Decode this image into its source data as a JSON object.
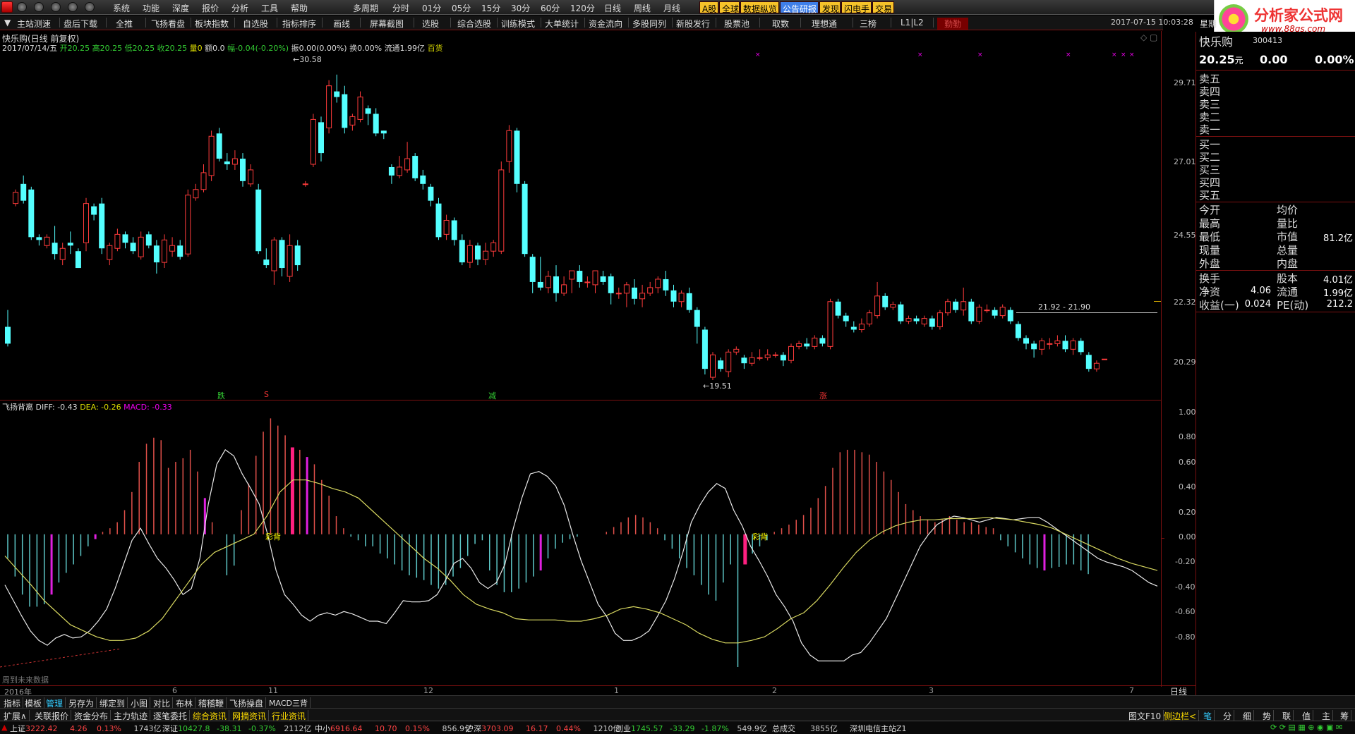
{
  "menu": [
    "系统",
    "功能",
    "深度",
    "报价",
    "分析",
    "工具",
    "帮助"
  ],
  "menu2": [
    "多周期",
    "分时",
    "01分",
    "05分",
    "15分",
    "30分",
    "60分",
    "120分",
    "日线",
    "周线",
    "月线"
  ],
  "highlight_tabs": [
    {
      "label": "A股",
      "bg": "#f6c32a"
    },
    {
      "label": "全球",
      "bg": "#f6c32a"
    },
    {
      "label": "数据纵览",
      "bg": "#f6c32a"
    },
    {
      "label": "公告研报",
      "bg": "#3f7fe8"
    },
    {
      "label": "发现",
      "bg": "#f6c32a"
    },
    {
      "label": "闪电手",
      "bg": "#f6c32a"
    },
    {
      "label": "交易",
      "bg": "#f6c32a"
    }
  ],
  "toolbar": [
    "主站测速",
    "盘后下载",
    "全推",
    "飞扬看盘",
    "板块指数",
    "自选股",
    "指标排序",
    "画线",
    "屏幕截图",
    "选股",
    "综合选股",
    "训练模式",
    "大单统计",
    "资金流向",
    "多股同列",
    "新股发行",
    "股票池",
    "取数",
    "理想通",
    "三榜",
    "L1|L2",
    "勤勤"
  ],
  "datetime": "2017-07-15  10:03:28",
  "weekday": "星期",
  "brand": {
    "title": "分析家公式网",
    "url": "www.88gs.com"
  },
  "stock": {
    "name": "快乐购",
    "code": "300413",
    "price": "20.25",
    "unit": "元",
    "change": "0.00",
    "pct": "0.00%"
  },
  "chart_title": "快乐购(日线 前复权)",
  "ohlc_line": {
    "date": "2017/07/14/五",
    "open": "开20.25",
    "high": "高20.25",
    "low": "低20.25",
    "close": "收20.25",
    "vol": "量0",
    "amt": "额0.0",
    "amp": "幅-0.04(-0.20%)",
    "zhen": "振0.00(0.00%)",
    "huan": "换0.00%",
    "liutong": "流通1.99亿",
    "sector": "百货"
  },
  "annotations": {
    "high": "30.58",
    "low": "19.51",
    "range": "21.92 - 21.90",
    "m_die": "跌",
    "m_s": "S",
    "m_jian": "减",
    "m_zhang": "涨"
  },
  "price_axis": [
    "29.71",
    "27.01",
    "24.55",
    "22.32",
    "20.29"
  ],
  "indicator": {
    "name": "飞扬背离",
    "diff": "DIFF: -0.43",
    "dea": "DEA: -0.26",
    "macd": "MACD: -0.33",
    "tag": "彩背",
    "future": "周到未来数据"
  },
  "macd_axis": [
    "1.00",
    "0.80",
    "0.60",
    "0.40",
    "0.20",
    "0.00",
    "-0.20",
    "-0.40",
    "-0.60",
    "-0.80"
  ],
  "time_axis": {
    "year": "2016年",
    "labels": [
      "6",
      "11",
      "12",
      "1",
      "2",
      "3",
      "7"
    ],
    "period": "日线"
  },
  "quote": {
    "sells": [
      "卖五",
      "卖四",
      "卖三",
      "卖二",
      "卖一"
    ],
    "buys": [
      "买一",
      "买二",
      "买三",
      "买四",
      "买五"
    ],
    "rows": [
      {
        "l1": "今开",
        "v1": "",
        "l2": "均价",
        "v2": ""
      },
      {
        "l1": "最高",
        "v1": "",
        "l2": "量比",
        "v2": ""
      },
      {
        "l1": "最低",
        "v1": "",
        "l2": "市值",
        "v2": "81.2亿"
      },
      {
        "l1": "现量",
        "v1": "",
        "l2": "总量",
        "v2": ""
      },
      {
        "l1": "外盘",
        "v1": "",
        "l2": "内盘",
        "v2": ""
      }
    ],
    "rows2": [
      {
        "l1": "换手",
        "v1": "",
        "l2": "股本",
        "v2": "4.01亿"
      },
      {
        "l1": "净资",
        "v1": "4.06",
        "l2": "流通",
        "v2": "1.99亿"
      },
      {
        "l1": "收益(一)",
        "v1": "0.024",
        "l2": "PE(动)",
        "v2": "212.2"
      }
    ]
  },
  "bottom_tabs1": [
    "指标",
    "模板",
    "管理",
    "另存为",
    "绑定到",
    "小图",
    "对比",
    "布林",
    "稽稽鞭",
    "飞扬操盘",
    "MACD三背"
  ],
  "bottom_tabs2": [
    "扩展∧",
    "关联报价",
    "资金分布",
    "主力轨迹",
    "逐笔委托",
    "综合资讯",
    "网摘资讯",
    "行业资讯"
  ],
  "right_bottom": {
    "tuwen": "图文F10",
    "cebian": "侧边栏<",
    "icons": [
      "笔",
      "分",
      "细",
      "势",
      "联",
      "值",
      "主",
      "筹"
    ]
  },
  "status": [
    {
      "name": "上证",
      "val": "3222.42",
      "chg": "4.26",
      "pct": "0.13%",
      "amt": "1743亿"
    },
    {
      "name": "深证",
      "val": "10427.8",
      "chg": "-38.31",
      "pct": "-0.37%",
      "amt": "2112亿"
    },
    {
      "name": "中小",
      "val": "6916.64",
      "chg": "10.70",
      "pct": "0.15%",
      "amt": "856.9亿"
    },
    {
      "name": "沪深",
      "val": "3703.09",
      "chg": "16.17",
      "pct": "0.44%",
      "amt": "1210亿"
    },
    {
      "name": "创业",
      "val": "1745.57",
      "chg": "-33.29",
      "pct": "-1.87%",
      "amt": "549.9亿"
    }
  ],
  "status_tail": {
    "label": "总成交",
    "amt": "3855亿",
    "server": "深圳电信主站Z1"
  },
  "chart_data": {
    "type": "candlestick",
    "y_range": [
      19.3,
      31.2
    ],
    "candles": [
      [
        21.4,
        20.8,
        22.0,
        20.7
      ],
      [
        25.8,
        26.2,
        26.3,
        25.7
      ],
      [
        26.5,
        25.9,
        26.8,
        25.8
      ],
      [
        26.3,
        24.6,
        26.4,
        24.5
      ],
      [
        24.6,
        24.5,
        24.7,
        24.3
      ],
      [
        24.3,
        24.6,
        24.7,
        24.2
      ],
      [
        24.4,
        24.0,
        25.0,
        23.8
      ],
      [
        23.8,
        24.2,
        24.4,
        23.6
      ],
      [
        24.4,
        24.3,
        24.8,
        24.0
      ],
      [
        24.1,
        23.5,
        24.2,
        23.5
      ],
      [
        24.4,
        25.8,
        26.0,
        24.1
      ],
      [
        25.7,
        25.4,
        25.8,
        25.2
      ],
      [
        25.8,
        24.2,
        26.0,
        24.0
      ],
      [
        23.8,
        24.3,
        24.4,
        23.6
      ],
      [
        24.2,
        24.7,
        24.9,
        24.1
      ],
      [
        24.7,
        24.4,
        24.8,
        24.2
      ],
      [
        24.4,
        24.1,
        24.6,
        24.0
      ],
      [
        23.9,
        24.6,
        24.8,
        23.8
      ],
      [
        24.7,
        24.3,
        24.8,
        24.2
      ],
      [
        24.3,
        23.7,
        24.5,
        23.3
      ],
      [
        23.7,
        24.5,
        24.7,
        23.5
      ],
      [
        24.1,
        24.3,
        24.6,
        23.9
      ],
      [
        24.3,
        23.9,
        24.5,
        23.8
      ],
      [
        24.0,
        26.1,
        26.3,
        23.9
      ],
      [
        26.0,
        26.3,
        26.5,
        25.9
      ],
      [
        26.3,
        26.9,
        27.2,
        26.2
      ],
      [
        26.8,
        28.2,
        28.4,
        26.6
      ],
      [
        28.3,
        27.4,
        28.5,
        27.3
      ],
      [
        27.3,
        27.2,
        27.6,
        27.0
      ],
      [
        27.2,
        27.4,
        27.7,
        27.0
      ],
      [
        27.4,
        26.6,
        27.6,
        26.4
      ],
      [
        26.5,
        27.0,
        27.2,
        26.4
      ],
      [
        26.3,
        24.1,
        26.5,
        24.0
      ],
      [
        23.8,
        23.6,
        24.2,
        23.5
      ],
      [
        23.4,
        24.5,
        24.6,
        22.9
      ],
      [
        24.5,
        23.5,
        24.6,
        23.2
      ],
      [
        23.2,
        24.3,
        24.7,
        23.0
      ],
      [
        24.3,
        23.6,
        24.5,
        23.4
      ],
      [
        26.5,
        26.5,
        26.6,
        26.4
      ],
      [
        27.2,
        28.8,
        29.0,
        27.1
      ],
      [
        28.7,
        27.6,
        28.9,
        27.3
      ],
      [
        28.5,
        30.0,
        30.2,
        28.3
      ],
      [
        29.8,
        29.6,
        30.4,
        29.4
      ],
      [
        29.7,
        28.5,
        30.0,
        28.3
      ],
      [
        28.6,
        28.9,
        29.0,
        28.4
      ],
      [
        28.8,
        29.6,
        29.8,
        28.7
      ],
      [
        29.2,
        29.0,
        29.3,
        28.6
      ],
      [
        29.0,
        28.3,
        29.2,
        28.2
      ],
      [
        28.4,
        28.3,
        28.4,
        28.1
      ],
      [
        27.1,
        26.8,
        27.2,
        26.5
      ],
      [
        26.8,
        27.1,
        27.5,
        26.7
      ],
      [
        27.0,
        27.4,
        28.0,
        26.9
      ],
      [
        27.5,
        26.7,
        27.6,
        26.6
      ],
      [
        26.8,
        26.5,
        27.0,
        26.3
      ],
      [
        26.4,
        25.9,
        26.5,
        25.7
      ],
      [
        25.8,
        24.6,
        26.0,
        24.5
      ],
      [
        24.7,
        25.2,
        25.4,
        24.5
      ],
      [
        25.2,
        24.5,
        25.3,
        24.3
      ],
      [
        24.5,
        23.7,
        24.7,
        23.6
      ],
      [
        23.7,
        24.3,
        24.5,
        23.5
      ],
      [
        24.3,
        23.8,
        24.4,
        23.6
      ],
      [
        23.8,
        24.1,
        24.4,
        23.6
      ],
      [
        24.1,
        24.4,
        24.5,
        23.9
      ],
      [
        24.1,
        27.0,
        27.3,
        24.0
      ],
      [
        27.3,
        28.4,
        28.6,
        26.9
      ],
      [
        28.4,
        26.5,
        28.5,
        26.2
      ],
      [
        26.5,
        24.0,
        26.6,
        23.9
      ],
      [
        23.9,
        23.0,
        24.0,
        22.6
      ],
      [
        23.0,
        22.8,
        23.9,
        22.7
      ],
      [
        22.8,
        23.2,
        23.4,
        22.6
      ],
      [
        23.2,
        22.6,
        23.6,
        22.3
      ],
      [
        22.6,
        22.9,
        23.2,
        22.5
      ],
      [
        23.1,
        23.4,
        23.4,
        22.6
      ],
      [
        23.4,
        23.0,
        23.6,
        22.8
      ],
      [
        23.0,
        23.0,
        23.2,
        22.8
      ],
      [
        22.9,
        23.4,
        23.4,
        22.6
      ],
      [
        23.2,
        23.0,
        23.4,
        22.9
      ],
      [
        23.2,
        22.6,
        23.3,
        22.2
      ],
      [
        22.6,
        22.6,
        22.8,
        22.4
      ],
      [
        22.6,
        22.9,
        23.0,
        22.1
      ],
      [
        22.8,
        22.4,
        23.1,
        22.2
      ],
      [
        22.4,
        22.6,
        22.9,
        22.1
      ],
      [
        22.6,
        22.8,
        23.0,
        22.5
      ],
      [
        22.8,
        23.1,
        23.2,
        22.6
      ],
      [
        23.1,
        22.7,
        23.4,
        22.5
      ],
      [
        22.7,
        22.3,
        22.9,
        22.1
      ],
      [
        22.3,
        22.6,
        22.7,
        22.1
      ],
      [
        22.6,
        22.0,
        22.8,
        21.9
      ],
      [
        22.0,
        21.4,
        22.1,
        20.8
      ],
      [
        21.3,
        19.9,
        21.4,
        19.7
      ],
      [
        19.6,
        20.4,
        20.5,
        19.5
      ],
      [
        20.2,
        19.9,
        20.3,
        19.8
      ],
      [
        19.8,
        20.5,
        20.6,
        19.6
      ],
      [
        20.5,
        20.6,
        20.7,
        20.4
      ],
      [
        20.3,
        20.1,
        20.4,
        19.9
      ],
      [
        20.1,
        20.3,
        20.5,
        20.0
      ],
      [
        20.3,
        20.3,
        20.6,
        20.2
      ],
      [
        20.3,
        20.4,
        20.6,
        20.2
      ],
      [
        20.4,
        20.4,
        20.5,
        20.3
      ],
      [
        20.4,
        20.2,
        20.5,
        20.0
      ],
      [
        20.2,
        20.7,
        20.8,
        20.1
      ],
      [
        20.7,
        20.8,
        20.9,
        20.6
      ],
      [
        20.8,
        20.7,
        21.0,
        20.6
      ],
      [
        20.7,
        21.0,
        21.1,
        20.6
      ],
      [
        21.0,
        20.8,
        21.1,
        20.7
      ],
      [
        20.7,
        22.3,
        22.4,
        20.6
      ],
      [
        22.3,
        21.8,
        22.4,
        21.7
      ],
      [
        21.8,
        21.6,
        21.9,
        21.4
      ],
      [
        21.4,
        21.3,
        21.6,
        21.2
      ],
      [
        21.3,
        21.5,
        21.7,
        21.2
      ],
      [
        21.5,
        21.9,
        22.0,
        21.4
      ],
      [
        21.8,
        22.5,
        23.0,
        21.7
      ],
      [
        22.5,
        22.1,
        22.6,
        22.0
      ],
      [
        22.1,
        22.2,
        22.3,
        22.0
      ],
      [
        22.2,
        21.6,
        22.3,
        21.5
      ],
      [
        21.6,
        21.7,
        21.8,
        21.5
      ],
      [
        21.7,
        21.6,
        21.8,
        21.5
      ],
      [
        21.5,
        21.7,
        21.8,
        21.4
      ],
      [
        21.7,
        21.4,
        21.8,
        21.3
      ],
      [
        21.4,
        21.9,
        22.0,
        21.3
      ],
      [
        21.9,
        22.3,
        22.4,
        21.8
      ],
      [
        22.3,
        22.0,
        22.4,
        21.9
      ],
      [
        22.0,
        22.3,
        22.8,
        21.8
      ],
      [
        22.3,
        21.6,
        22.4,
        21.5
      ],
      [
        21.6,
        22.1,
        22.2,
        21.5
      ],
      [
        22.0,
        22.0,
        22.2,
        21.9
      ],
      [
        22.0,
        21.8,
        22.1,
        21.7
      ],
      [
        21.8,
        22.1,
        22.2,
        21.7
      ],
      [
        22.0,
        21.6,
        22.1,
        21.5
      ],
      [
        21.5,
        21.0,
        21.6,
        20.9
      ],
      [
        21.0,
        20.8,
        21.1,
        20.6
      ],
      [
        20.8,
        20.6,
        20.9,
        20.3
      ],
      [
        20.6,
        20.9,
        21.0,
        20.4
      ],
      [
        20.8,
        20.8,
        21.0,
        20.6
      ],
      [
        20.8,
        20.9,
        21.1,
        20.7
      ],
      [
        20.9,
        20.6,
        21.1,
        20.5
      ],
      [
        20.6,
        20.9,
        21.0,
        20.4
      ],
      [
        20.9,
        20.5,
        21.0,
        20.4
      ],
      [
        20.4,
        19.9,
        20.5,
        19.8
      ],
      [
        19.9,
        20.1,
        20.2,
        19.8
      ],
      [
        20.25,
        20.25,
        20.25,
        20.25
      ]
    ],
    "markers": [
      "跌",
      "S",
      "减",
      "涨"
    ],
    "macd_range": [
      -1.1,
      1.05
    ],
    "macd_hist": [
      -0.2,
      -0.35,
      -0.5,
      -0.6,
      -0.6,
      -0.58,
      -0.5,
      -0.4,
      -0.32,
      -0.25,
      -0.18,
      -0.1,
      -0.04,
      0.02,
      0.05,
      0.1,
      0.2,
      0.35,
      0.6,
      0.75,
      0.8,
      0.78,
      0.55,
      0.6,
      0.63,
      0.7,
      0.52,
      0.3,
      0.1,
      0.0,
      -0.34,
      -0.26,
      0.2,
      0.42,
      0.65,
      0.85,
      0.96,
      0.9,
      0.82,
      0.72,
      0.7,
      0.64,
      0.58,
      0.45,
      0.32,
      0.15,
      0.05,
      -0.02,
      -0.05,
      -0.1,
      -0.1,
      -0.16,
      -0.2,
      -0.25,
      -0.3,
      -0.34,
      -0.36,
      -0.38,
      -0.42,
      -0.45,
      -0.42,
      -0.35,
      -0.28,
      -0.18,
      -0.08,
      -0.05,
      -0.3,
      -0.42,
      -0.48,
      -0.48,
      -0.45,
      -0.4,
      -0.35,
      -0.3,
      -0.2,
      -0.12,
      -0.07,
      -0.04,
      -0.02,
      0.0,
      0.0,
      0.0,
      0.02,
      0.06,
      0.1,
      0.14,
      0.16,
      0.14,
      0.1,
      0.05,
      -0.05,
      -0.12,
      -0.2,
      -0.28,
      -0.34,
      -0.42,
      -0.5,
      -0.55,
      -0.4,
      -0.25,
      -1.1,
      -0.25,
      -0.16,
      -0.1,
      -0.05,
      0.02,
      0.05,
      0.08,
      0.12,
      0.16,
      0.22,
      0.3,
      0.4,
      0.55,
      0.68,
      0.7,
      0.7,
      0.68,
      0.66,
      0.6,
      0.52,
      0.45,
      0.35,
      0.25,
      0.2,
      0.15,
      0.12,
      0.1,
      0.12,
      0.15,
      0.12,
      0.1,
      0.1,
      0.08,
      0.06,
      0.05,
      -0.05,
      -0.1,
      -0.15,
      -0.2,
      -0.25,
      -0.28,
      -0.3,
      -0.28,
      -0.27,
      -0.25,
      -0.25,
      -0.3,
      -0.33
    ],
    "diff": [
      -0.42,
      -0.55,
      -0.68,
      -0.8,
      -0.88,
      -0.92,
      -0.86,
      -0.83,
      -0.86,
      -0.85,
      -0.8,
      -0.72,
      -0.62,
      -0.45,
      -0.25,
      -0.05,
      0.05,
      -0.08,
      -0.2,
      -0.28,
      -0.38,
      -0.5,
      -0.45,
      -0.2,
      0.25,
      0.58,
      0.7,
      0.65,
      0.5,
      0.38,
      0.25,
      0.0,
      -0.3,
      -0.5,
      -0.58,
      -0.67,
      -0.72,
      -0.67,
      -0.65,
      -0.67,
      -0.64,
      -0.66,
      -0.69,
      -0.72,
      -0.72,
      -0.74,
      -0.65,
      -0.55,
      -0.56,
      -0.56,
      -0.55,
      -0.5,
      -0.38,
      -0.24,
      -0.2,
      -0.28,
      -0.4,
      -0.45,
      -0.4,
      -0.25,
      0.05,
      0.3,
      0.5,
      0.52,
      0.48,
      0.4,
      0.24,
      0.0,
      -0.22,
      -0.4,
      -0.58,
      -0.68,
      -0.82,
      -0.88,
      -0.88,
      -0.85,
      -0.8,
      -0.68,
      -0.55,
      -0.37,
      -0.15,
      0.1,
      0.24,
      0.35,
      0.42,
      0.38,
      0.2,
      0.07,
      -0.1,
      -0.22,
      -0.35,
      -0.5,
      -0.6,
      -0.72,
      -0.9,
      -1.0,
      -1.05,
      -1.05,
      -1.05,
      -1.05,
      -1.0,
      -0.98,
      -0.9,
      -0.8,
      -0.7,
      -0.55,
      -0.4,
      -0.25,
      -0.1,
      0.0,
      0.08,
      0.12,
      0.15,
      0.14,
      0.12,
      0.1,
      0.12,
      0.14,
      0.13,
      0.12,
      0.13,
      0.14,
      0.14,
      0.1,
      0.05,
      0.0,
      -0.05,
      -0.1,
      -0.15,
      -0.2,
      -0.23,
      -0.25,
      -0.27,
      -0.3,
      -0.35,
      -0.4,
      -0.43
    ],
    "dea": [
      -0.18,
      -0.3,
      -0.42,
      -0.55,
      -0.65,
      -0.75,
      -0.8,
      -0.85,
      -0.88,
      -0.88,
      -0.86,
      -0.8,
      -0.7,
      -0.55,
      -0.4,
      -0.25,
      -0.15,
      -0.1,
      -0.05,
      0.0,
      0.15,
      0.35,
      0.45,
      0.45,
      0.42,
      0.38,
      0.35,
      0.3,
      0.2,
      0.1,
      0.0,
      -0.1,
      -0.2,
      -0.28,
      -0.38,
      -0.5,
      -0.58,
      -0.62,
      -0.65,
      -0.7,
      -0.71,
      -0.71,
      -0.71,
      -0.72,
      -0.72,
      -0.7,
      -0.67,
      -0.62,
      -0.6,
      -0.62,
      -0.65,
      -0.7,
      -0.75,
      -0.82,
      -0.87,
      -0.9,
      -0.9,
      -0.88,
      -0.85,
      -0.78,
      -0.7,
      -0.65,
      -0.55,
      -0.42,
      -0.28,
      -0.15,
      -0.05,
      0.02,
      0.07,
      0.1,
      0.12,
      0.12,
      0.13,
      0.13,
      0.13,
      0.14,
      0.13,
      0.12,
      0.1,
      0.08,
      0.05,
      0.0,
      -0.05,
      -0.1,
      -0.15,
      -0.2,
      -0.24,
      -0.27,
      -0.3
    ]
  }
}
